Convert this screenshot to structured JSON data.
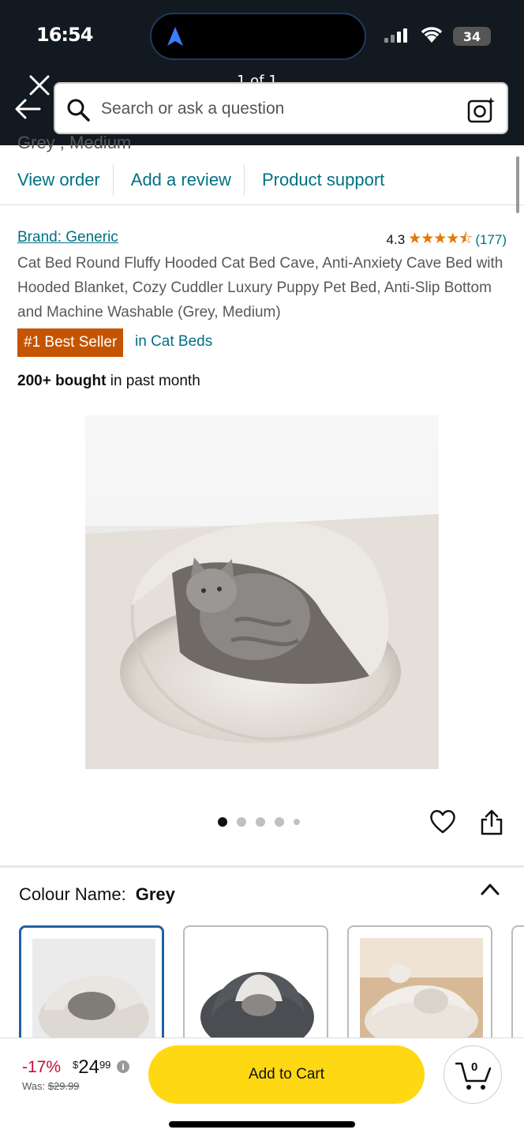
{
  "status_bar": {
    "time": "16:54",
    "battery": "34"
  },
  "header": {
    "page_counter": "1 of 1",
    "search_placeholder": "Search or ask a question"
  },
  "order": {
    "cut_text": "Grey , Medium",
    "links": [
      "View order",
      "Add a review",
      "Product support"
    ]
  },
  "product": {
    "brand": "Brand: Generic",
    "rating": "4.3",
    "stars": "★★★★⯪",
    "rating_count": "(177)",
    "title": "Cat Bed Round Fluffy Hooded Cat Bed Cave, Anti-Anxiety Cave Bed with Hooded Blanket, Cozy Cuddler Luxury Puppy Pet Bed, Anti-Slip Bottom and Machine Washable (Grey, Medium)",
    "badge": "#1 Best Seller",
    "badge_category": "in Cat Beds",
    "bought_bold": "200+ bought",
    "bought_rest": " in past month",
    "image_count": 5,
    "active_image": 1
  },
  "colour": {
    "label": "Colour Name:",
    "value": "Grey",
    "swatches": [
      "grey-fluffy",
      "dark-grey",
      "beige-with-cat",
      "partial"
    ]
  },
  "purchase": {
    "discount": "-17%",
    "currency": "$",
    "price_whole": "24",
    "price_fraction": "99",
    "info": "i",
    "was_label": "Was:",
    "was_price": "$29.99",
    "add_to_cart": "Add to Cart",
    "cart_count": "0"
  },
  "colors": {
    "header_bg": "#131921",
    "link": "#007185",
    "badge": "#c45500",
    "cart_button": "#ffd814",
    "discount": "#cc0c39",
    "stars": "#e67a00"
  }
}
